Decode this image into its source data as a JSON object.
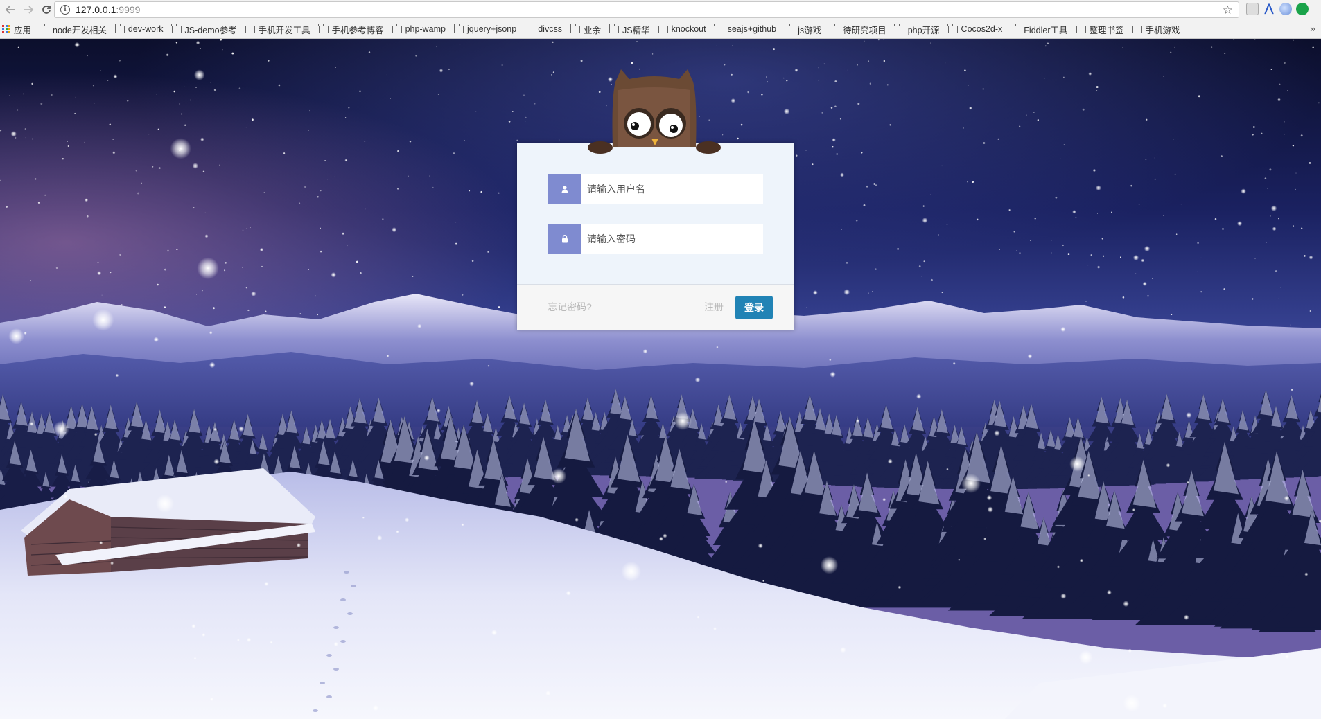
{
  "browser": {
    "url_host": "127.0.0.1",
    "url_port": ":9999",
    "apps_label": "应用",
    "bookmarks": [
      "node开发相关",
      "dev-work",
      "JS-demo参考",
      "手机开发工具",
      "手机参考博客",
      "php-wamp",
      "jquery+jsonp",
      "divcss",
      "业余",
      "JS精华",
      "knockout",
      "seajs+github",
      "js游戏",
      "待研究项目",
      "php开源",
      "Cocos2d-x",
      "Fiddler工具",
      "整理书签",
      "手机游戏"
    ],
    "more_label": "»"
  },
  "login": {
    "username_placeholder": "请输入用户名",
    "password_placeholder": "请输入密码",
    "forgot_label": "忘记密码?",
    "register_label": "注册",
    "submit_label": "登录"
  },
  "colors": {
    "sky_top": "#0d1030",
    "sky_mid": "#2a3280",
    "panel_bg": "#eef4fb",
    "icon_bg": "#7f8bd0",
    "button_bg": "#2183b5"
  },
  "icons": {
    "user_icon": "user-icon",
    "lock_icon": "lock-icon",
    "owl": "owl-mascot"
  }
}
